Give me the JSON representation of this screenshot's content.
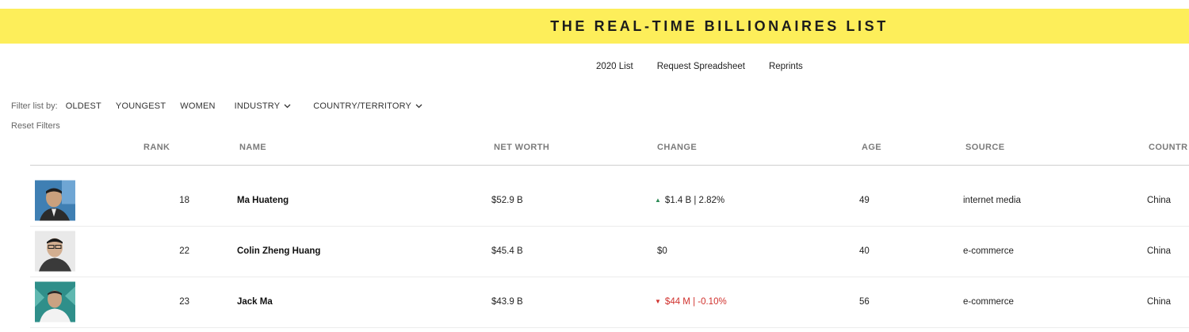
{
  "banner": {
    "title": "THE REAL-TIME BILLIONAIRES LIST"
  },
  "subnav": [
    "2020 List",
    "Request Spreadsheet",
    "Reprints"
  ],
  "filters": {
    "label": "Filter list by:",
    "options": [
      "OLDEST",
      "YOUNGEST",
      "WOMEN",
      "INDUSTRY",
      "COUNTRY/TERRITORY"
    ],
    "reset": "Reset Filters"
  },
  "table": {
    "headers": [
      "RANK",
      "NAME",
      "NET WORTH",
      "CHANGE",
      "AGE",
      "SOURCE",
      "COUNTR"
    ],
    "rows": [
      {
        "rank": "18",
        "name": "Ma Huateng",
        "net_worth": "$52.9 B",
        "change": "$1.4 B | 2.82%",
        "direction": "up",
        "age": "49",
        "source": "internet media",
        "country": "China"
      },
      {
        "rank": "22",
        "name": "Colin Zheng Huang",
        "net_worth": "$45.4 B",
        "change": "$0",
        "direction": "none",
        "age": "40",
        "source": "e-commerce",
        "country": "China"
      },
      {
        "rank": "23",
        "name": "Jack Ma",
        "net_worth": "$43.9 B",
        "change": "$44 M | -0.10%",
        "direction": "down",
        "age": "56",
        "source": "e-commerce",
        "country": "China"
      }
    ]
  },
  "colors": {
    "banner": "#fdee5a",
    "up": "#2e8b57",
    "down": "#d0312d",
    "header_text": "#7b7b7b"
  },
  "icons": {
    "dropdown": "chevron-down-icon",
    "up": "triangle-up-icon",
    "down": "triangle-down-icon"
  }
}
